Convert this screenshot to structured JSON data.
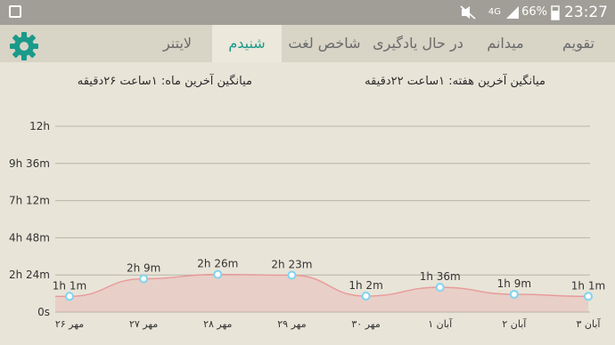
{
  "status_bar": {
    "notification_icon": "image-icon",
    "mute_icon": "mute-icon",
    "network": "4G",
    "signal_icon": "signal-icon",
    "battery": "66%",
    "time": "23:27"
  },
  "tabs": [
    {
      "label": "تقویم",
      "active": false
    },
    {
      "label": "میدانم",
      "active": false
    },
    {
      "label": "در حال یادگیری",
      "active": false
    },
    {
      "label": "شاخص لغت",
      "active": false
    },
    {
      "label": "شنیدم",
      "active": true
    },
    {
      "label": "لایتنر",
      "active": false
    }
  ],
  "settings_icon": "gear-icon",
  "accent_color": "#1a9a8a",
  "summary": {
    "week": "میانگین آخرین هفته: ۱ساعت  ۲۲دقیقه",
    "month": "میانگین آخرین ماه: ۱ساعت  ۲۶دقیقه"
  },
  "chart_data": {
    "type": "area",
    "y_unit": "minutes",
    "yticks": [
      "0s",
      "2h 24m",
      "4h 48m",
      "7h 12m",
      "9h 36m",
      "12h"
    ],
    "ylim": [
      0,
      720
    ],
    "categories": [
      "۲۶ مهر",
      "۲۷ مهر",
      "۲۸ مهر",
      "۲۹ مهر",
      "۳۰ مهر",
      "۱ آبان",
      "۲ آبان",
      "۳ آبان"
    ],
    "values": [
      61,
      129,
      146,
      143,
      62,
      96,
      69,
      61
    ],
    "data_labels": [
      "1h 1m",
      "2h 9m",
      "2h 26m",
      "2h 23m",
      "1h 2m",
      "1h 36m",
      "1h 9m",
      "1h 1m"
    ],
    "line_color": "#e89a9a",
    "point_color": "#7fd4f0",
    "grid": true
  }
}
